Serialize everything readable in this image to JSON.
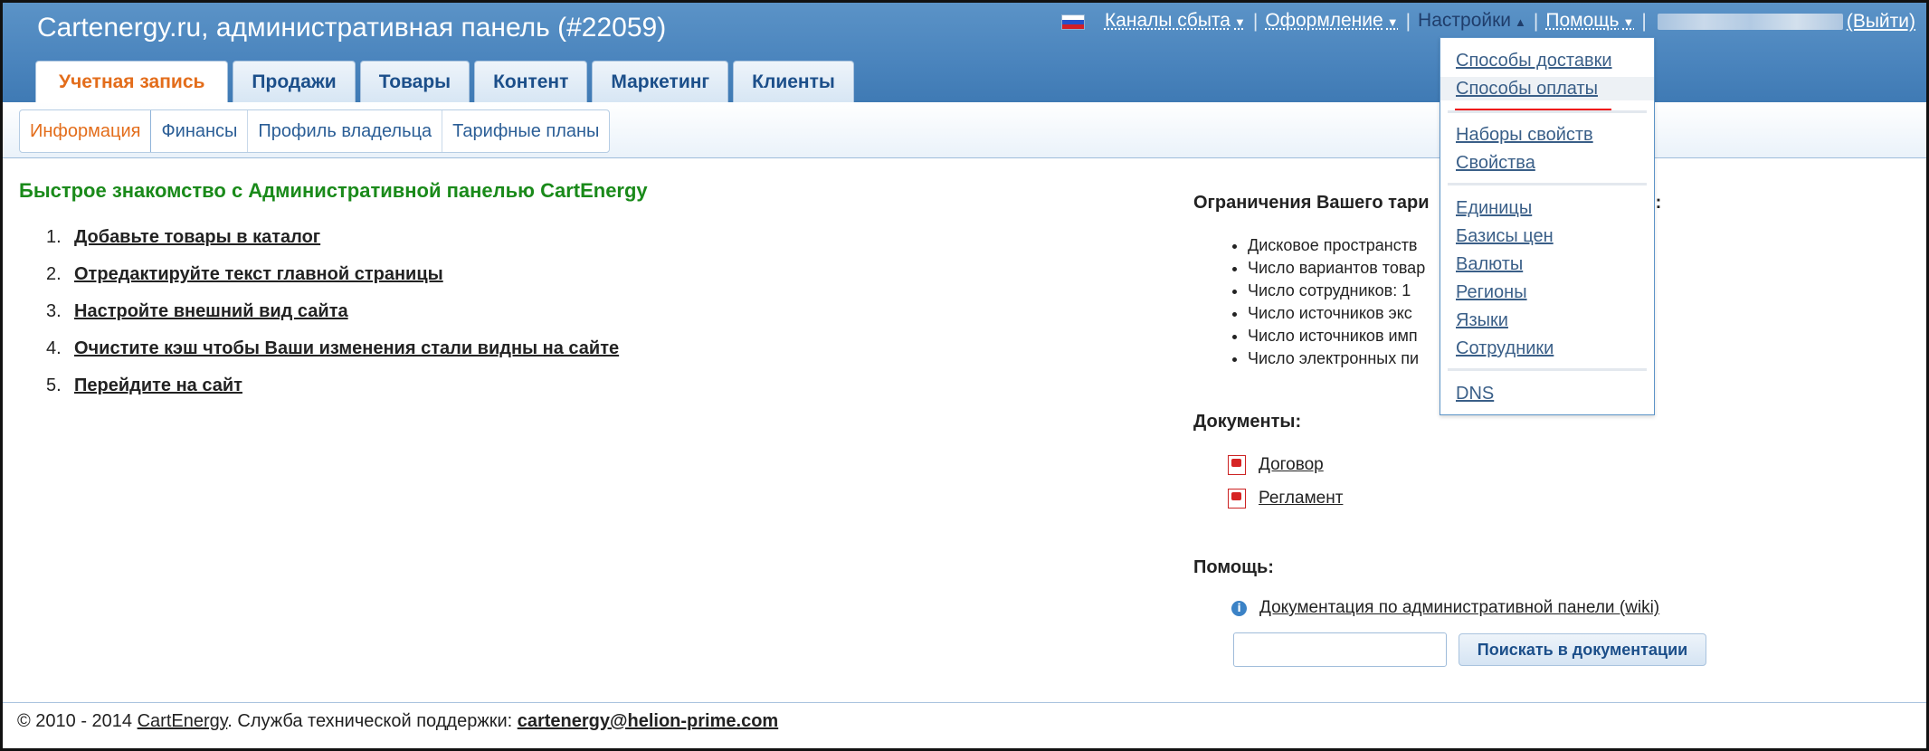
{
  "header": {
    "title": "Cartenergy.ru, административная панель (#22059)",
    "topnav": {
      "sales_channels": "Каналы сбыта",
      "design": "Оформление",
      "settings": "Настройки",
      "help": "Помощь",
      "logout": "(Выйти)",
      "arrow_down": "▼",
      "arrow_up": "▲",
      "separator": "|"
    }
  },
  "main_tabs": [
    {
      "label": "Учетная запись",
      "active": true
    },
    {
      "label": "Продажи"
    },
    {
      "label": "Товары"
    },
    {
      "label": "Контент"
    },
    {
      "label": "Маркетинг"
    },
    {
      "label": "Клиенты"
    }
  ],
  "sub_tabs": [
    {
      "label": "Информация",
      "active": true
    },
    {
      "label": "Финансы"
    },
    {
      "label": "Профиль владельца"
    },
    {
      "label": "Тарифные планы"
    }
  ],
  "quick_start": {
    "title": "Быстрое знакомство с Административной панелью CartEnergy",
    "steps": [
      {
        "num": "1.",
        "text": "Добавьте товары в каталог"
      },
      {
        "num": "2.",
        "text": "Отредактируйте текст главной страницы"
      },
      {
        "num": "3.",
        "text": "Настройте внешний вид сайта"
      },
      {
        "num": "4.",
        "text": "Очистите кэш чтобы Ваши изменения стали видны на сайте"
      },
      {
        "num": "5.",
        "text": "Перейдите на сайт"
      }
    ]
  },
  "limits": {
    "title": "Ограничения Вашего тари",
    "title_tail": "):",
    "items": [
      "Дисковое пространств",
      "Число вариантов товар",
      "Число сотрудников: 1",
      "Число источников экс",
      "Число источников имп",
      "Число электронных пи"
    ]
  },
  "documents": {
    "title": "Документы:",
    "items": [
      "Договор",
      "Регламент"
    ]
  },
  "help": {
    "title": "Помощь:",
    "link": "Документация по административной панели (wiki)",
    "search_placeholder": "",
    "search_button": "Поискать в документации"
  },
  "settings_menu": {
    "items": [
      "Способы доставки",
      "Способы оплаты",
      "Наборы свойств",
      "Свойства",
      "Единицы",
      "Базисы цен",
      "Валюты",
      "Регионы",
      "Языки",
      "Сотрудники",
      "DNS"
    ],
    "highlighted": "Способы оплаты"
  },
  "footer": {
    "copyright": "© 2010 - 2014 ",
    "brand": "CartEnergy",
    "support_text": ". Служба технической поддержки: ",
    "email": "cartenergy@helion-prime.com"
  },
  "colors": {
    "header_blue": "#4a84bd",
    "active_tab_orange": "#e36d1b",
    "quick_title_green": "#1a8a1a",
    "annotation_red": "#ee1111"
  }
}
